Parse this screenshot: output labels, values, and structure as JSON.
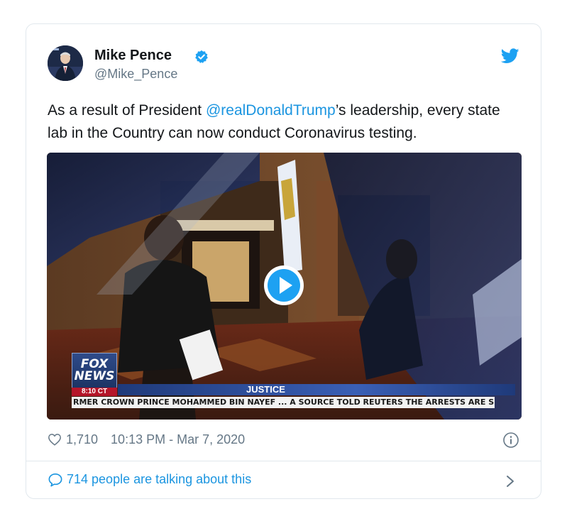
{
  "tweet": {
    "author_name": "Mike Pence",
    "author_handle": "@Mike_Pence",
    "text_before": "As a result of President ",
    "mention": "@realDonaldTrump",
    "text_after": "’s leadership, every state lab in the Country can now conduct Coronavirus testing.",
    "likes": "1,710",
    "timestamp": "10:13 PM - Mar 7, 2020",
    "conversation": "714 people are talking about this"
  },
  "video": {
    "logo_line1": "FOX",
    "logo_line2": "NEWS",
    "logo_time": "8:10 CT",
    "banner": "JUSTICE",
    "ticker": "RMER CROWN PRINCE MOHAMMED BIN NAYEF ...   A SOURCE TOLD REUTERS THE ARRESTS ARE SEEN AS C"
  },
  "icons": {
    "verified": "verified-badge-icon",
    "bird": "twitter-bird-icon",
    "play": "play-icon",
    "heart": "heart-icon",
    "info": "info-icon",
    "bubble": "speech-bubble-icon",
    "chevron": "chevron-right-icon"
  },
  "colors": {
    "link": "#1b95e0",
    "muted": "#657786",
    "border": "#e1e8ed",
    "text": "#14171a"
  }
}
